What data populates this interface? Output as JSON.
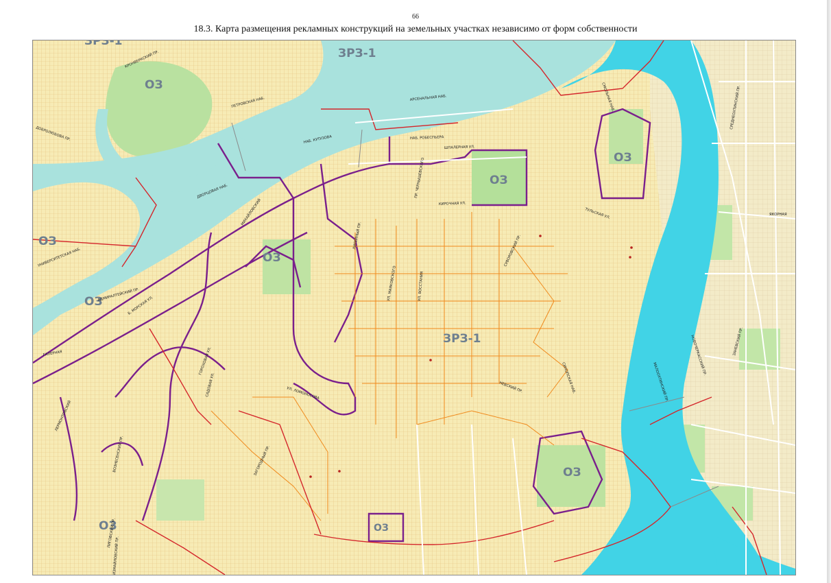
{
  "page_number": "66",
  "title": "18.3. Карта размещения рекламных конструкций на земельных участках независимо от форм собственности",
  "colors": {
    "water": "#a9e2dd",
    "river": "#3fd4e8",
    "park": "#b4e09a",
    "built": "#f5e7a8",
    "block_grid": "#e8c98a",
    "zone_boundary": "#d4262b",
    "parcel_boundary": "#f08a1c",
    "protected_zone": "#7a1f8c"
  },
  "zone_labels": [
    {
      "id": "oz-1",
      "text": "ОЗ"
    },
    {
      "id": "oz-2",
      "text": "ОЗ"
    },
    {
      "id": "oz-3",
      "text": "ОЗ"
    },
    {
      "id": "oz-4",
      "text": "ОЗ"
    },
    {
      "id": "oz-5",
      "text": "ОЗ"
    },
    {
      "id": "oz-6",
      "text": "ОЗ"
    },
    {
      "id": "oz-7",
      "text": "ОЗ"
    },
    {
      "id": "oz-8",
      "text": "ОЗ"
    },
    {
      "id": "oz-9",
      "text": "ОЗ"
    },
    {
      "id": "zrz-1",
      "text": "ЗРЗ-1"
    },
    {
      "id": "zrz-2",
      "text": "ЗРЗ-1"
    },
    {
      "id": "zrz-3",
      "text": "ЗРЗ-1"
    }
  ],
  "street_labels": [
    {
      "id": "arsenalnaya",
      "text": "АРСЕНАЛЬНАЯ НАБ."
    },
    {
      "id": "robespiera",
      "text": "НАБ. РОБЕСПЬЕРА"
    },
    {
      "id": "shpalernaya",
      "text": "ШПАЛЕРНАЯ УЛ."
    },
    {
      "id": "kutuzova",
      "text": "НАБ. КУТУЗОВА"
    },
    {
      "id": "kirochnaya",
      "text": "КИРОЧНАЯ УЛ."
    },
    {
      "id": "tulskaya",
      "text": "ТУЛЬСКАЯ УЛ."
    },
    {
      "id": "smolnaya",
      "text": "СМОЛЬНАЯ НАБ."
    },
    {
      "id": "yakornaya",
      "text": "ЯКОРНАЯ"
    },
    {
      "id": "nevsky",
      "text": "НЕВСКИЙ ПР."
    },
    {
      "id": "sinopskaya",
      "text": "СИНОПСКАЯ НАБ."
    },
    {
      "id": "suvorovsky",
      "text": "СУВОРОВСКИЙ ПР."
    },
    {
      "id": "ligovsky",
      "text": "ЛИГОВСКИЙ ПР."
    },
    {
      "id": "zagorodny",
      "text": "ЗАГОРОДНЫЙ ПР."
    },
    {
      "id": "gorokhovaya",
      "text": "ГОРОХОВАЯ УЛ."
    },
    {
      "id": "voznesensky",
      "text": "ВОЗНЕСЕНСКИЙ ПР."
    },
    {
      "id": "admiralteysky",
      "text": "АДМИРАЛТЕЙСКИЙ ПР."
    },
    {
      "id": "dvortsovaya",
      "text": "ДВОРЦОВАЯ НАБ."
    },
    {
      "id": "kronverksky",
      "text": "КРОНВЕРКСКИЙ ПР."
    },
    {
      "id": "petrovskaya",
      "text": "ПЕТРОВСКАЯ НАБ."
    },
    {
      "id": "dobrolyubova",
      "text": "ДОБРОЛЮБОВА ПР."
    },
    {
      "id": "universitetskaya",
      "text": "УНИВЕРСИТЕТСКАЯ НАБ."
    },
    {
      "id": "malookhtinsky",
      "text": "МАЛООХТИНСКИЙ ПР."
    },
    {
      "id": "novocherkassky",
      "text": "НОВОЧЕРКАССКИЙ ПР."
    },
    {
      "id": "zanevsky",
      "text": "ЗАНЕВСКИЙ ПР."
    },
    {
      "id": "sredneokhtinsky",
      "text": "СРЕДНЕОХТИНСКИЙ ПР."
    },
    {
      "id": "vosstaniya",
      "text": "УЛ. ВОССТАНИЯ"
    },
    {
      "id": "mayakovskogo",
      "text": "УЛ. МАЯКОВСКОГО"
    },
    {
      "id": "chernyshevskogo",
      "text": "ПР. ЧЕРНЫШЕВСКОГО"
    },
    {
      "id": "liteyny",
      "text": "ЛИТЕЙНЫЙ ПР."
    },
    {
      "id": "lomonosova",
      "text": "УЛ. ЛОМОНОСОВА"
    },
    {
      "id": "sadovaya",
      "text": "САДОВАЯ УЛ."
    },
    {
      "id": "mikhaylovsky",
      "text": "МИХАЙЛОВСКИЙ"
    },
    {
      "id": "morskaya",
      "text": "Б. МОРСКАЯ УЛ."
    },
    {
      "id": "galernaya",
      "text": "ГАЛЕРНАЯ"
    },
    {
      "id": "ismaylovsky",
      "text": "ИЗМАЙЛОВСКИЙ ПР."
    },
    {
      "id": "lermontovsky",
      "text": "ЛЕРМОНТОВСКИЙ"
    }
  ]
}
